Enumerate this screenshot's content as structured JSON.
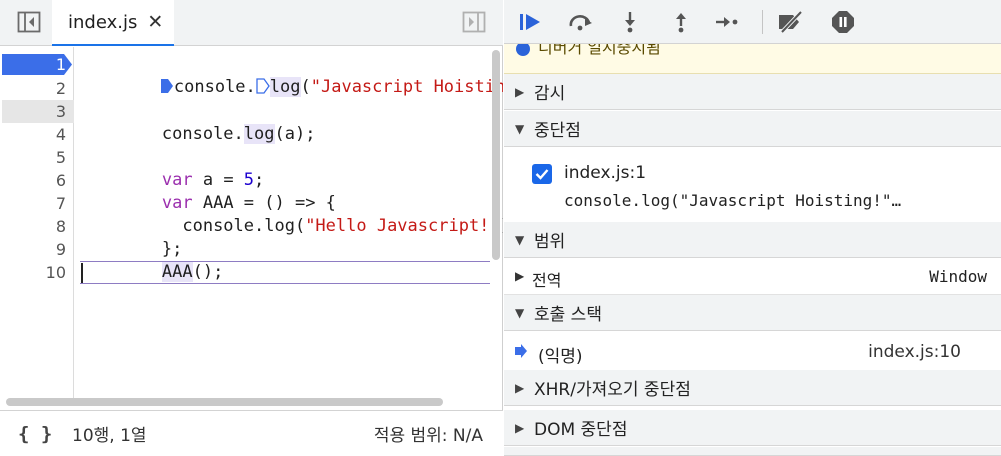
{
  "editor": {
    "tab_label": "index.js",
    "tab_close": "✕",
    "lines": [
      {
        "num": "1"
      },
      {
        "num": "2"
      },
      {
        "num": "3"
      },
      {
        "num": "4"
      },
      {
        "num": "5"
      },
      {
        "num": "6"
      },
      {
        "num": "7"
      },
      {
        "num": "8"
      },
      {
        "num": "9"
      },
      {
        "num": "10"
      }
    ],
    "code": {
      "l1_a": "console.",
      "l1_b": "log",
      "l1_c": "(",
      "l1_d": "\"Javascript Hoisting",
      "l3_a": "console.",
      "l3_b": "log",
      "l3_c": "(a);",
      "l5_kw": "var",
      "l5_rest": " a = ",
      "l5_num": "5",
      "l5_end": ";",
      "l6_kw": "var",
      "l6_rest": " AAA = () => {",
      "l7_a": "  console.log(",
      "l7_str": "\"Hello Javascript!\"",
      "l7_end": ");",
      "l8": "};",
      "l9_a": "AAA",
      "l9_b": "();"
    }
  },
  "statusbar": {
    "braces": "{ }",
    "position": "10행, 1열",
    "scope": "적용 범위: N/A"
  },
  "debugger": {
    "toolbar_icons": [
      "resume-icon",
      "step-over-icon",
      "step-into-icon",
      "step-out-icon",
      "step-icon",
      "deactivate-breakpoints-icon",
      "pause-on-exceptions-icon"
    ],
    "paused_text": "디버거 일시중지됨",
    "sections": {
      "watch": "감시",
      "breakpoints": "중단점",
      "scope": "범위",
      "call_stack": "호출 스택",
      "xhr": "XHR/가져오기 중단점",
      "dom": "DOM 중단점"
    },
    "breakpoint": {
      "file": "index.js:1",
      "code": "console.log(\"Javascript Hoisting!\"…",
      "checked": true
    },
    "scope_row": {
      "name": "전역",
      "value": "Window"
    },
    "call_frame": {
      "name": "(익명)",
      "location": "index.js:10"
    }
  },
  "colors": {
    "accent": "#1a73e8",
    "breakpoint": "#3b6ee8",
    "keyword": "#9b2fae",
    "string": "#c41a16",
    "number": "#1c00cf"
  }
}
